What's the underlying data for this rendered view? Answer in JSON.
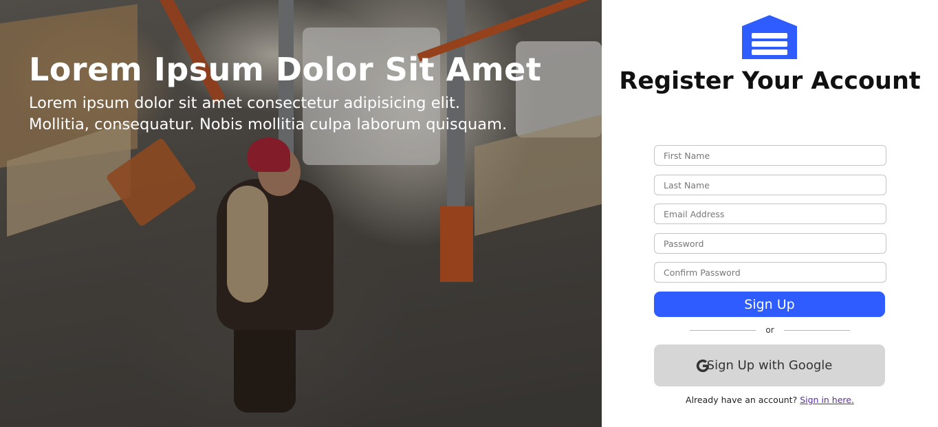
{
  "hero": {
    "title": "Lorem Ipsum Dolor Sit Amet",
    "subtitle_line1": "Lorem ipsum dolor sit amet consectetur adipisicing elit.",
    "subtitle_line2": "Mollitia, consequatur. Nobis mollitia culpa laborum quisquam."
  },
  "form": {
    "logo_icon": "warehouse-icon",
    "title": "Register Your Account",
    "fields": [
      {
        "placeholder": "First Name",
        "value": ""
      },
      {
        "placeholder": "Last Name",
        "value": ""
      },
      {
        "placeholder": "Email Address",
        "value": ""
      },
      {
        "placeholder": "Password",
        "value": ""
      },
      {
        "placeholder": "Confirm Password",
        "value": ""
      }
    ],
    "signup_label": "Sign Up",
    "divider_text": "or",
    "google_icon": "google-icon",
    "google_label": "Sign Up with Google",
    "footer_text": "Already have an account?",
    "footer_link": "Sign in here."
  },
  "colors": {
    "accent": "#2f5cff",
    "google_button_bg": "#d6d6d6",
    "link": "#5a2ca0"
  }
}
